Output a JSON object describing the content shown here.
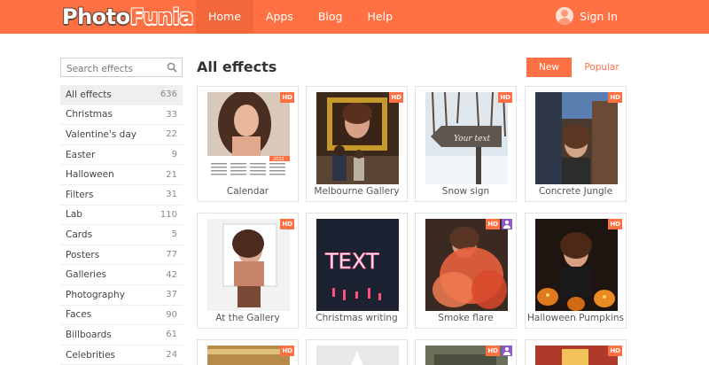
{
  "header": {
    "logo": {
      "part1": "Photo",
      "part2": "Funia"
    },
    "nav": [
      {
        "label": "Home",
        "active": true
      },
      {
        "label": "Apps",
        "active": false
      },
      {
        "label": "Blog",
        "active": false
      },
      {
        "label": "Help",
        "active": false
      }
    ],
    "signin_label": "Sign In"
  },
  "sidebar": {
    "search_placeholder": "Search effects",
    "categories": [
      {
        "label": "All effects",
        "count": "636",
        "active": true
      },
      {
        "label": "Christmas",
        "count": "33"
      },
      {
        "label": "Valentine's day",
        "count": "22"
      },
      {
        "label": "Easter",
        "count": "9"
      },
      {
        "label": "Halloween",
        "count": "21"
      },
      {
        "label": "Filters",
        "count": "31"
      },
      {
        "label": "Lab",
        "count": "110"
      },
      {
        "label": "Cards",
        "count": "5"
      },
      {
        "label": "Posters",
        "count": "77"
      },
      {
        "label": "Galleries",
        "count": "42"
      },
      {
        "label": "Photography",
        "count": "37"
      },
      {
        "label": "Faces",
        "count": "90"
      },
      {
        "label": "Billboards",
        "count": "61"
      },
      {
        "label": "Celebrities",
        "count": "24"
      }
    ]
  },
  "main": {
    "title": "All effects",
    "sort": {
      "new_label": "New",
      "popular_label": "Popular"
    },
    "effects": [
      {
        "label": "Calendar",
        "hd": "HD",
        "year": "2022"
      },
      {
        "label": "Melbourne Gallery",
        "hd": "HD"
      },
      {
        "label": "Snow sign",
        "hd": "HD",
        "sign_text": "Your text"
      },
      {
        "label": "Concrete Jungle",
        "hd": "HD"
      },
      {
        "label": "At the Gallery",
        "hd": "HD"
      },
      {
        "label": "Christmas writing",
        "hd": "",
        "text": "TEXT"
      },
      {
        "label": "Smoke flare",
        "hd": "HD"
      },
      {
        "label": "Halloween Pumpkins",
        "hd": "HD"
      }
    ],
    "partial_hd": "HD"
  },
  "colors": {
    "accent": "#ff7043",
    "user_badge": "#8d5bc5"
  }
}
